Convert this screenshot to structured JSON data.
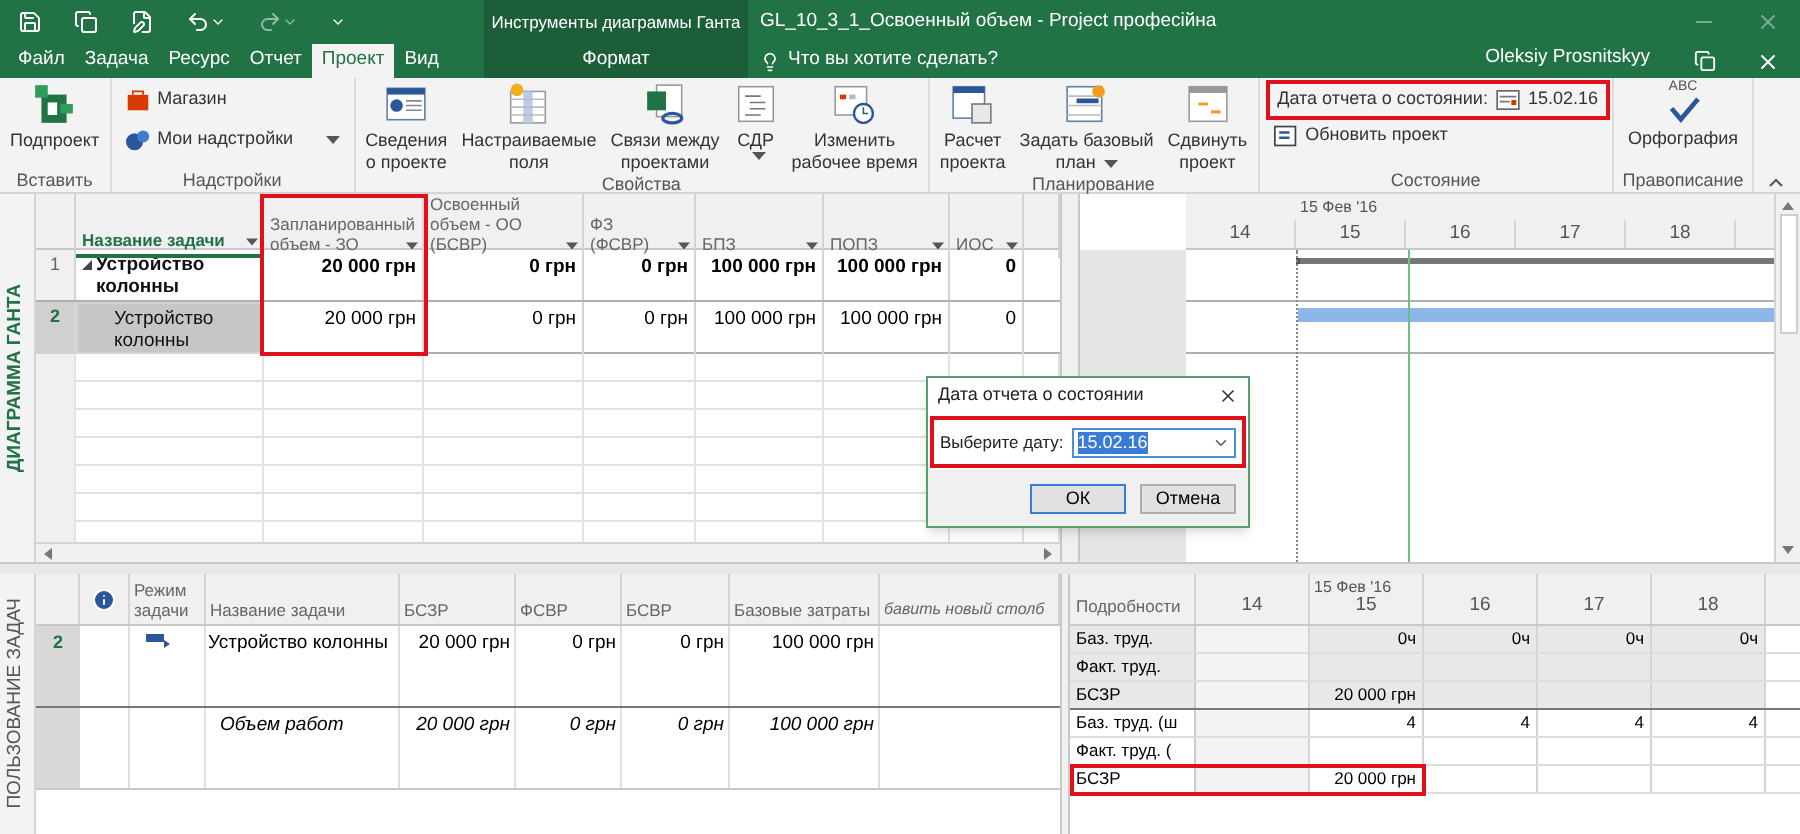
{
  "window": {
    "contextual_group": "Инструменты диаграммы Ганта",
    "title": "GL_10_3_1_Освоенный объем - Project професійна",
    "user": "Oleksiy Prosnitskyy"
  },
  "tabs": [
    {
      "label": "Файл",
      "selected": false,
      "kind": "normal"
    },
    {
      "label": "Задача",
      "selected": false,
      "kind": "normal"
    },
    {
      "label": "Ресурс",
      "selected": false,
      "kind": "normal"
    },
    {
      "label": "Отчет",
      "selected": false,
      "kind": "normal"
    },
    {
      "label": "Проект",
      "selected": true,
      "kind": "normal"
    },
    {
      "label": "Вид",
      "selected": false,
      "kind": "normal"
    },
    {
      "label": "Формат",
      "selected": false,
      "kind": "contextual"
    }
  ],
  "tell_me": "Что вы хотите сделать?",
  "ribbon": {
    "groups": [
      {
        "label": "Вставить",
        "commands": [
          {
            "kind": "large",
            "lines": [
              "Подпроект"
            ],
            "dropdown": false
          }
        ]
      },
      {
        "label": "Надстройки",
        "commands": [
          {
            "kind": "small",
            "lines": [
              "Магазин"
            ],
            "dropdown": false
          },
          {
            "kind": "small",
            "lines": [
              "Мои надстройки"
            ],
            "dropdown": true
          }
        ]
      },
      {
        "label": "Свойства",
        "commands": [
          {
            "kind": "large",
            "lines": [
              "Сведения",
              "о проекте"
            ],
            "dropdown": false
          },
          {
            "kind": "large",
            "lines": [
              "Настраиваемые",
              "поля"
            ],
            "dropdown": false
          },
          {
            "kind": "large",
            "lines": [
              "Связи между",
              "проектами"
            ],
            "dropdown": false
          },
          {
            "kind": "large",
            "lines": [
              "СДР"
            ],
            "dropdown": true
          },
          {
            "kind": "large",
            "lines": [
              "Изменить",
              "рабочее время"
            ],
            "dropdown": false
          }
        ]
      },
      {
        "label": "Планирование",
        "commands": [
          {
            "kind": "large",
            "lines": [
              "Расчет",
              "проекта"
            ],
            "dropdown": false
          },
          {
            "kind": "large",
            "lines": [
              "Задать базовый",
              "план"
            ],
            "dropdown": true
          },
          {
            "kind": "large",
            "lines": [
              "Сдвинуть",
              "проект"
            ],
            "dropdown": false
          }
        ]
      },
      {
        "label": "Состояние",
        "commands": [
          {
            "kind": "status_date",
            "lines": [
              "Дата отчета о состоянии:"
            ],
            "value": "15.02.16",
            "dropdown": false,
            "highlight": true
          },
          {
            "kind": "small",
            "lines": [
              "Обновить проект"
            ],
            "dropdown": false,
            "highlight": false
          }
        ]
      },
      {
        "label": "Правописание",
        "commands": [
          {
            "kind": "spelling",
            "badge": "ABC",
            "lines": [
              "Орфография"
            ],
            "dropdown": false
          }
        ]
      }
    ]
  },
  "gantt_view": {
    "side_label": "ДИАГРАММА ГАНТА",
    "columns": [
      {
        "label": "Название задачи",
        "selected": true,
        "highlight": false
      },
      {
        "label": "Запланированный объем - ЗО",
        "selected": false,
        "highlight": true
      },
      {
        "label": "Освоенный объем - ОО (БСВР)",
        "selected": false,
        "highlight": false
      },
      {
        "label": "ФЗ (ФСВР)",
        "selected": false,
        "highlight": false
      },
      {
        "label": "БПЗ",
        "selected": false,
        "highlight": false
      },
      {
        "label": "ПОПЗ",
        "selected": false,
        "highlight": false
      },
      {
        "label": "ИОС",
        "selected": false,
        "highlight": false
      }
    ],
    "rows": [
      {
        "id": "1",
        "name": "Устройство колонны",
        "summary": true,
        "selected": false,
        "values": [
          "20 000 грн",
          "0 грн",
          "0 грн",
          "100 000 грн",
          "100 000 грн",
          "0"
        ]
      },
      {
        "id": "2",
        "name": "Устройство колонны",
        "summary": false,
        "selected": true,
        "values": [
          "20 000 грн",
          "0 грн",
          "0 грн",
          "100 000 грн",
          "100 000 грн",
          "0"
        ]
      }
    ],
    "timescale": {
      "top": "15 Фев '16",
      "days": [
        "14",
        "15",
        "16",
        "17",
        "18"
      ]
    }
  },
  "dialog": {
    "title": "Дата отчета о состоянии",
    "label": "Выберите дату:",
    "value": "15.02.16",
    "field_highlight": true,
    "buttons": [
      {
        "label": "ОК",
        "kind": "default"
      },
      {
        "label": "Отмена",
        "kind": "normal"
      }
    ]
  },
  "usage_view": {
    "side_label": "ПОЛЬЗОВАНИЕ ЗАДАЧ",
    "columns": [
      "Режим задачи",
      "Название задачи",
      "БСЗР",
      "ФСВР",
      "БСВР",
      "Базовые затраты",
      "бавить новый столб"
    ],
    "rows": [
      {
        "id": "2",
        "kind": "task",
        "name": "Устройство колонны",
        "values": [
          "20 000 грн",
          "0 грн",
          "0 грн",
          "100 000 грн"
        ]
      },
      {
        "kind": "assignment",
        "name": "Объем работ",
        "values": [
          "20 000 грн",
          "0 грн",
          "0 грн",
          "100 000 грн"
        ]
      }
    ],
    "details_label": "Подробности",
    "timescale": {
      "top": "15 Фев '16",
      "days": [
        "14",
        "15",
        "16",
        "17",
        "18"
      ]
    },
    "detail_rows": [
      {
        "label": "Баз. труд.",
        "kind": "task",
        "highlight": false,
        "cells": [
          "",
          "0ч",
          "0ч",
          "0ч",
          "0ч"
        ]
      },
      {
        "label": "Факт. труд.",
        "kind": "task",
        "highlight": false,
        "cells": [
          "",
          "",
          "",
          "",
          ""
        ]
      },
      {
        "label": "БСЗР",
        "kind": "task",
        "highlight": false,
        "cells": [
          "",
          "20 000 грн",
          "",
          "",
          ""
        ]
      },
      {
        "label": "Баз. труд.  (ш",
        "kind": "assignment",
        "highlight": false,
        "cells": [
          "",
          "4",
          "4",
          "4",
          "4"
        ]
      },
      {
        "label": "Факт. труд. (",
        "kind": "assignment",
        "highlight": false,
        "cells": [
          "",
          "",
          "",
          "",
          ""
        ]
      },
      {
        "label": "БСЗР",
        "kind": "assignment",
        "highlight": true,
        "cells": [
          "",
          "20 000 грн",
          "",
          "",
          ""
        ]
      }
    ]
  }
}
